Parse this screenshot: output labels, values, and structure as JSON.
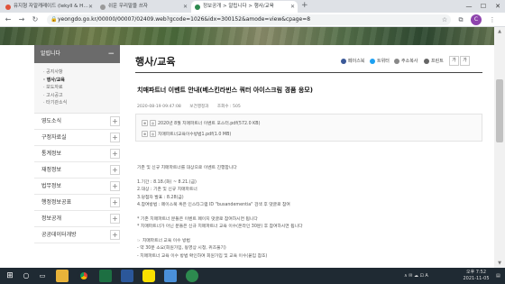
{
  "browser": {
    "tabs": [
      {
        "title": "유지형 자알캐레이드 (lekyll & H…",
        "active": false
      },
      {
        "title": "쉬운 우리말을 쓰자",
        "active": false
      },
      {
        "title": "정보공개 > 알립니다 > 행사/교육",
        "active": true
      }
    ],
    "new_tab": "+",
    "window_buttons": [
      "—",
      "☐",
      "✕"
    ],
    "address": "yeongdo.go.kr/00000/00007/02409.web?gcode=1026&idx=300152&amode=view&cpage=8",
    "profile_initial": "C"
  },
  "sidebar": {
    "title": "알립니다",
    "subitems": [
      {
        "label": "· 공지사항",
        "active": false
      },
      {
        "label": "· 행사/교육",
        "active": true
      },
      {
        "label": "· 보도자료",
        "active": false
      },
      {
        "label": "· 고시공고",
        "active": false
      },
      {
        "label": "· 타기관소식",
        "active": false
      }
    ],
    "items": [
      {
        "label": "영도소식"
      },
      {
        "label": "구정자료실"
      },
      {
        "label": "통계정보"
      },
      {
        "label": "재정정보"
      },
      {
        "label": "법무정보"
      },
      {
        "label": "행정정보공표"
      },
      {
        "label": "정보공개"
      },
      {
        "label": "공공데이터개방"
      }
    ]
  },
  "content": {
    "heading": "행사/교육",
    "util": {
      "facebook": "페이스북",
      "twitter": "트위터",
      "copy": "주소복사",
      "print": "프린트",
      "font": "가",
      "font_small": "가"
    },
    "post": {
      "title": "치매파트너 이벤트 안내(베스킨라빈스 쿼터 아이스크림 경품 응모)",
      "date": "2020-08-19 09:47:08",
      "dept": "보건행정과",
      "views": "조회수 : 505"
    },
    "attachments": [
      {
        "name": "2020년 8월 치매파트너 이벤트 포스터.pdf(572.0 KB)"
      },
      {
        "name": "치매파트너교육이수방법1.pdf(1.0 MB)"
      }
    ],
    "body": [
      "",
      "기존 및 신규 치매파트너를 대상으로 이벤트 진행합니다",
      "",
      "1.기간 : 8.18.(화) ~ 8.21.(금)",
      "2.대상 : 기존 및 신규 치매파트너",
      "3.당첨자 발표 : 8.28(금)",
      "4.참여방법 : 페이스북 혹은 인스타그램 ID \"busandementia\" 검색 후 댓글로 참여",
      "",
      " * 기존 치매파트너 분들은 이벤트 페이지 댓글로 참여하시면 됩니다",
      " * 치매파트너가 아닌 분들은 신규 치매파트너 교육 이수(온라인 30분) 후 참여하시면 됩니다",
      "",
      " ☞ 치매파트너 교육 이수 방법",
      "  - 약 30분 소요(회원가입, 동영상 시청, 퀴즈풀기)",
      "  - 치매파트너 교육 이수 방법 확인하여 회원가입 및 교육 이수(붙임 참조)"
    ]
  },
  "taskbar": {
    "tray": "∧  ✉  ☁  ⊡  A",
    "time": "오후 7:52",
    "date": "2021-11-05"
  },
  "colors": {
    "sidebar_head": "#6b6b6b",
    "taskbar": "#1f2a33",
    "facebook": "#3b5998",
    "twitter": "#1da1f2",
    "accent_icon": "#1a73e8"
  }
}
